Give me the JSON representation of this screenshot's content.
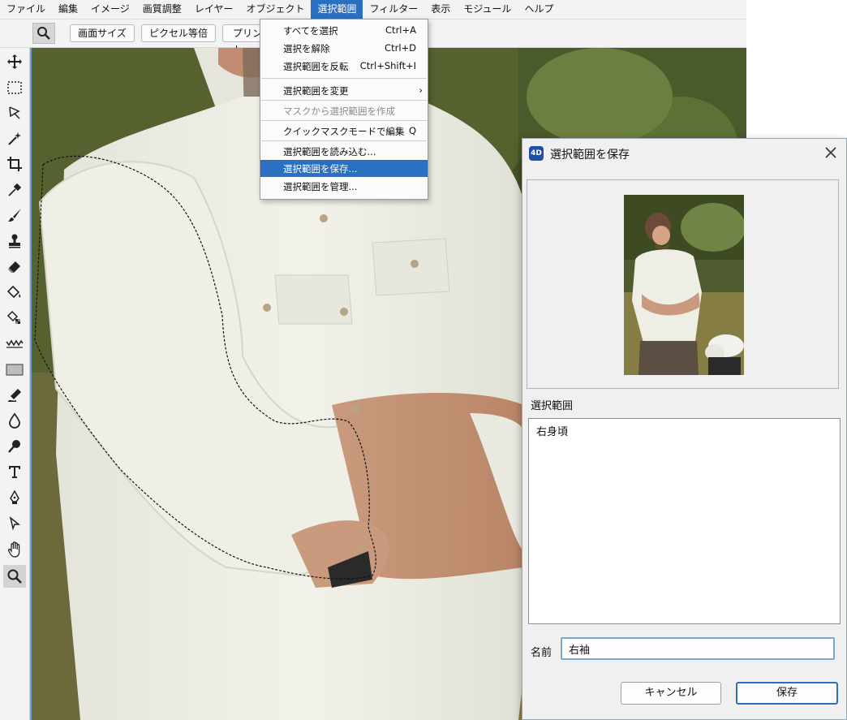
{
  "menubar": {
    "items": [
      "ファイル",
      "編集",
      "イメージ",
      "画質調整",
      "レイヤー",
      "オブジェクト",
      "選択範囲",
      "フィルター",
      "表示",
      "モジュール",
      "ヘルプ"
    ],
    "active": "選択範囲"
  },
  "options_bar": {
    "tool_icon": "zoom-icon",
    "buttons": [
      "画面サイズ",
      "ピクセル等倍",
      "プリント"
    ]
  },
  "toolbar": {
    "tools": [
      "move-icon",
      "rect-marquee-icon",
      "lasso-icon",
      "magic-wand-icon",
      "crop-icon",
      "eyedropper-icon",
      "brush-icon",
      "stamp-icon",
      "eraser-icon",
      "fill-bucket-icon",
      "pattern-fill-icon",
      "wave-icon",
      "rectangle-shape-icon",
      "smudge-icon",
      "blur-drop-icon",
      "dodge-icon",
      "text-icon",
      "pen-icon",
      "path-select-icon",
      "hand-icon",
      "zoom-icon"
    ],
    "active": "zoom-icon"
  },
  "dropdown": {
    "items": [
      {
        "label": "すべてを選択",
        "shortcut": "Ctrl+A"
      },
      {
        "label": "選択を解除",
        "shortcut": "Ctrl+D"
      },
      {
        "label": "選択範囲を反転",
        "shortcut": "Ctrl+Shift+I"
      },
      {
        "label": "選択範囲を変更",
        "shortcut": "›"
      },
      {
        "label": "マスクから選択範囲を作成",
        "shortcut": "",
        "disabled": true
      },
      {
        "label": "クイックマスクモードで編集",
        "shortcut": "Q"
      },
      {
        "label": "選択範囲を読み込む...",
        "shortcut": ""
      },
      {
        "label": "選択範囲を保存...",
        "shortcut": "",
        "highlighted": true
      },
      {
        "label": "選択範囲を管理...",
        "shortcut": ""
      }
    ]
  },
  "dialog": {
    "title": "選択範囲を保存",
    "section_label": "選択範囲",
    "list_items": [
      "右身頃"
    ],
    "name_label": "名前",
    "name_value": "右袖",
    "cancel_label": "キャンセル",
    "save_label": "保存"
  },
  "colors": {
    "accent": "#2b6fc0",
    "menu_bg": "#f3f3f3"
  }
}
